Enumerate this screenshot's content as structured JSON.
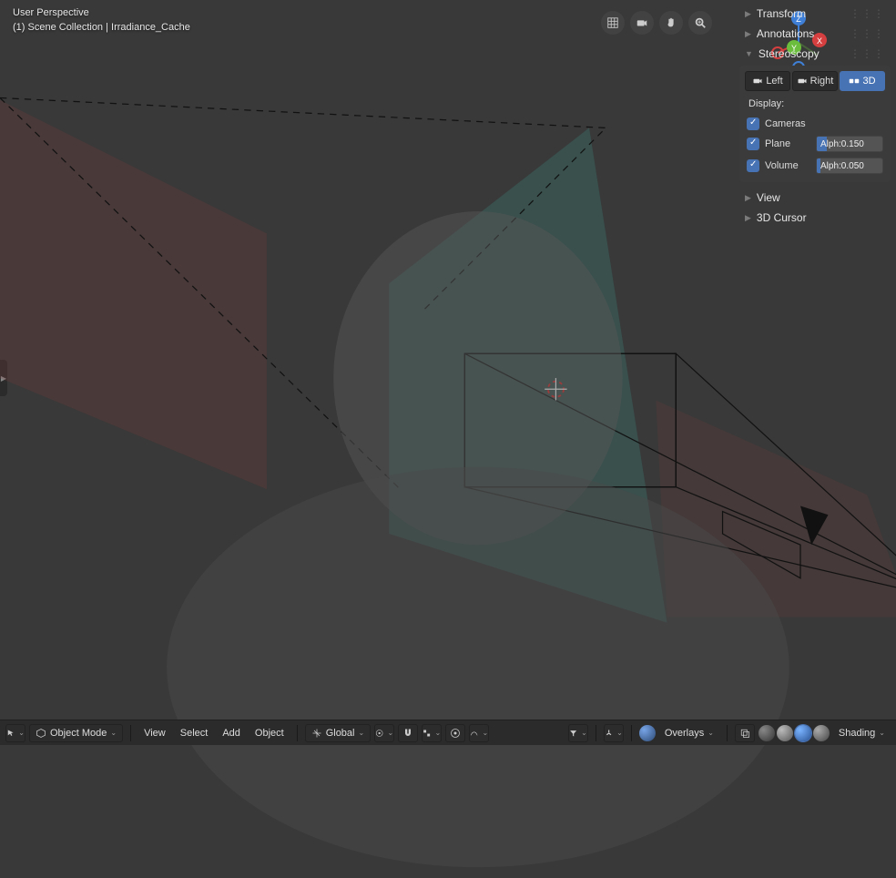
{
  "overlay": {
    "line1": "User Perspective",
    "line2": "(1) Scene Collection | Irradiance_Cache"
  },
  "gizmo": {
    "axes": {
      "x": "X",
      "y": "Y",
      "z": "Z"
    },
    "colors": {
      "x": "#d63f3f",
      "y": "#6bbd3e",
      "z": "#3f7fd6"
    }
  },
  "top_buttons": {
    "grid": "grid-icon",
    "camera": "camera-icon",
    "hand": "hand-icon",
    "zoom": "zoom-icon"
  },
  "panels": {
    "transform": {
      "label": "Transform",
      "expanded": false
    },
    "annotations": {
      "label": "Annotations",
      "expanded": false
    },
    "stereoscopy": {
      "label": "Stereoscopy",
      "expanded": true,
      "tabs": [
        {
          "id": "left",
          "label": "Left",
          "active": false
        },
        {
          "id": "right",
          "label": "Right",
          "active": false
        },
        {
          "id": "3d",
          "label": "3D",
          "active": true
        }
      ],
      "display_label": "Display:",
      "rows": {
        "cameras": {
          "label": "Cameras",
          "checked": true
        },
        "plane": {
          "label": "Plane",
          "checked": true,
          "value_label": "Alph:0.150",
          "fill": 0.15
        },
        "volume": {
          "label": "Volume",
          "checked": true,
          "value_label": "Alph:0.050",
          "fill": 0.05
        }
      }
    },
    "view": {
      "label": "View",
      "expanded": false
    },
    "cursor": {
      "label": "3D Cursor",
      "expanded": false
    }
  },
  "bottom": {
    "cursor_menu": "cursor",
    "mode": "Object Mode",
    "menus": {
      "view": "View",
      "select": "Select",
      "add": "Add",
      "object": "Object"
    },
    "orientation": "Global",
    "overlays_label": "Overlays",
    "shading_label": "Shading"
  }
}
